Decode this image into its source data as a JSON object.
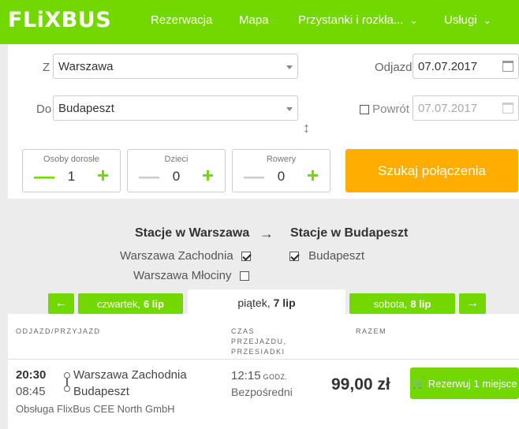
{
  "header": {
    "logo": "FLiXBUS",
    "nav": [
      {
        "label": "Rezerwacja"
      },
      {
        "label": "Mapa"
      },
      {
        "label": "Przystanki i rozkła...",
        "dropdown": true
      },
      {
        "label": "Usługi",
        "dropdown": true
      }
    ]
  },
  "search": {
    "from_label": "Z",
    "from_value": "Warszawa",
    "to_label": "Do",
    "to_value": "Budapeszt",
    "departure_label": "Odjazd",
    "departure_value": "07.07.2017",
    "return_label": "Powrót",
    "return_value": "07.07.2017",
    "return_checked": false,
    "adults_label": "Osoby dorosłe",
    "adults_value": "1",
    "children_label": "Dzieci",
    "children_value": "0",
    "bikes_label": "Rowery",
    "bikes_value": "0",
    "submit_label": "Szukaj połączenia"
  },
  "stations": {
    "from_heading": "Stacje w Warszawa",
    "to_heading": "Stacje w Budapeszt",
    "arrow": "→",
    "from_items": [
      {
        "name": "Warszawa Zachodnia",
        "checked": true
      },
      {
        "name": "Warszawa Młociny",
        "checked": false
      }
    ],
    "to_items": [
      {
        "name": "Budapeszt",
        "checked": true
      }
    ]
  },
  "days": {
    "prev_arrow": "←",
    "next_arrow": "→",
    "prev_day": "czwartek,",
    "prev_date": "6 lip",
    "current_day": "piątek,",
    "current_date": "7 lip",
    "next_day": "sobota,",
    "next_date": "8 lip"
  },
  "results": {
    "col_departure": "ODJAZD/PRZYJAZD",
    "col_duration": [
      "CZAS",
      "PRZEJAZDU,",
      "PRZESIADKI"
    ],
    "col_price": "RAZEM",
    "rows": [
      {
        "departure_time": "20:30",
        "arrival_time": "08:45",
        "from_station": "Warszawa Zachodnia",
        "to_station": "Budapeszt",
        "operator": "Obsługa FlixBus CEE North GmbH",
        "duration": "12:15",
        "duration_unit": "GODZ.",
        "transfers": "Bezpośredni",
        "price": "99,00 zł",
        "book_label": "Rezerwuj 1 miejsce"
      }
    ]
  },
  "colors": {
    "brand_green": "#73d700",
    "search_orange": "#ffad00"
  }
}
